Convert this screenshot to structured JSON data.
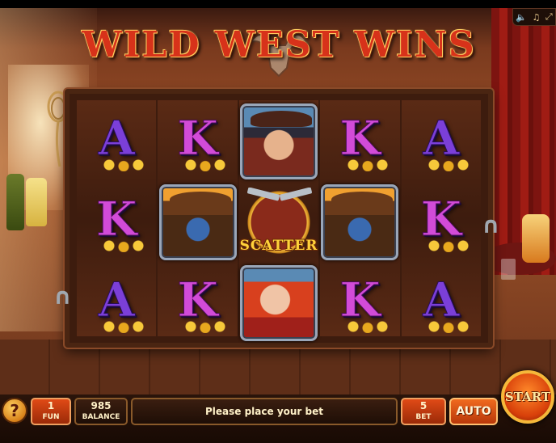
{
  "game": {
    "title": "WILD WEST WINS"
  },
  "controls": {
    "sound_icon": "speaker-icon",
    "music_icon": "music-note-icon",
    "fullscreen_icon": "fullscreen-icon"
  },
  "reels": [
    [
      "A",
      "K",
      "A"
    ],
    [
      "K",
      "bandit",
      "K"
    ],
    [
      "cowgirl",
      "scatter",
      "redhead"
    ],
    [
      "K",
      "bandit",
      "K"
    ],
    [
      "A",
      "K",
      "A"
    ]
  ],
  "symbols": {
    "scatter_label": "SCATTER"
  },
  "bottom_bar": {
    "help_label": "?",
    "fun_value": "1",
    "fun_label": "FUN",
    "balance_value": "985",
    "balance_label": "BALANCE",
    "message": "Please place your bet",
    "bet_value": "5",
    "bet_label": "BET",
    "auto_label": "AUTO",
    "start_label": "START"
  },
  "colors": {
    "letter_A": "#7b3fd8",
    "letter_K": "#d24bd8",
    "title": "#d7321a",
    "accent_orange": "#e04a16"
  }
}
